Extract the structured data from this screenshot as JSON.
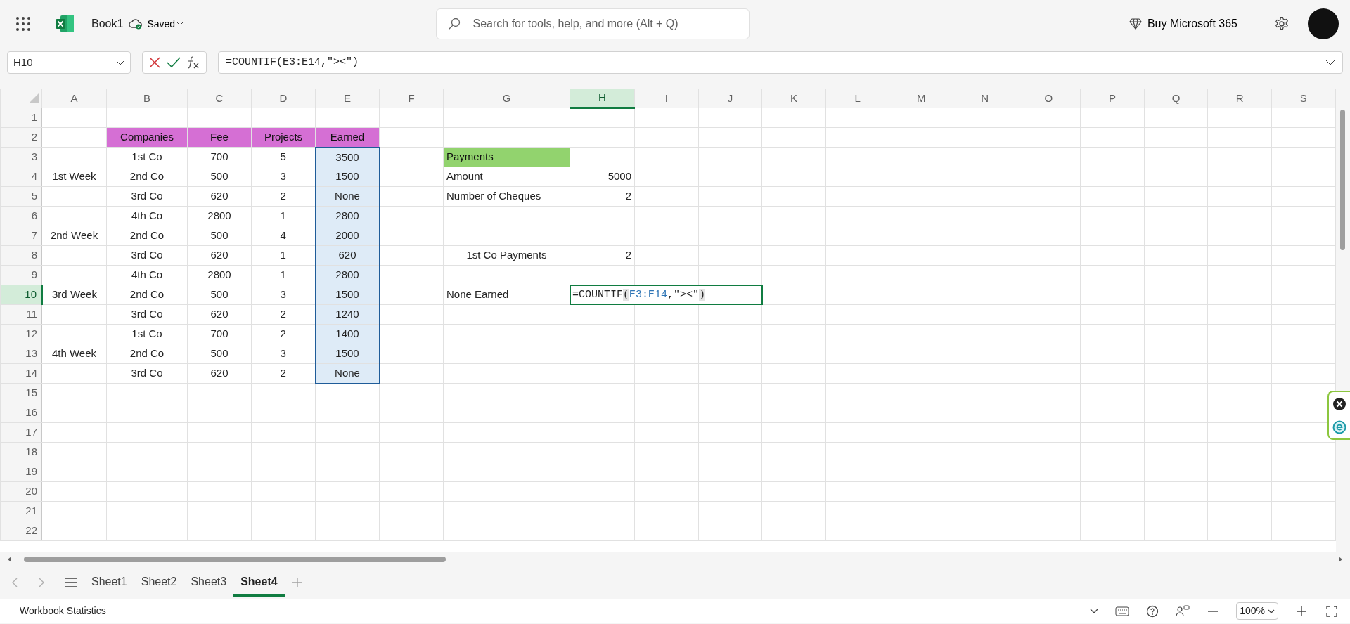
{
  "app": {
    "file_name": "Book1",
    "save_status": "Saved"
  },
  "search": {
    "placeholder": "Search for tools, help, and more (Alt + Q)"
  },
  "buy_button": "Buy Microsoft 365",
  "formula_bar": {
    "name_box": "H10",
    "formula": "=COUNTIF(E3:E14,\"><\")"
  },
  "grid": {
    "columns": [
      {
        "label": "A",
        "selected": false
      },
      {
        "label": "B",
        "selected": false
      },
      {
        "label": "C",
        "selected": false
      },
      {
        "label": "D",
        "selected": false
      },
      {
        "label": "E",
        "selected": false
      },
      {
        "label": "F",
        "selected": false
      },
      {
        "label": "G",
        "selected": false
      },
      {
        "label": "H",
        "selected": true
      },
      {
        "label": "I",
        "selected": false
      },
      {
        "label": "J",
        "selected": false
      },
      {
        "label": "K",
        "selected": false
      },
      {
        "label": "L",
        "selected": false
      },
      {
        "label": "M",
        "selected": false
      },
      {
        "label": "N",
        "selected": false
      },
      {
        "label": "O",
        "selected": false
      },
      {
        "label": "P",
        "selected": false
      },
      {
        "label": "Q",
        "selected": false
      },
      {
        "label": "R",
        "selected": false
      },
      {
        "label": "S",
        "selected": false
      }
    ],
    "rows": [
      {
        "label": "1",
        "selected": false,
        "cells": {}
      },
      {
        "label": "2",
        "selected": false,
        "cells": {
          "B": {
            "text": "Companies",
            "kind": "header",
            "selected": false
          },
          "C": {
            "text": "Fee",
            "kind": "header",
            "selected": false
          },
          "D": {
            "text": "Projects",
            "kind": "header",
            "selected": false
          },
          "E": {
            "text": "Earned",
            "kind": "header",
            "selected": false
          }
        }
      },
      {
        "label": "3",
        "selected": false,
        "cells": {
          "B": {
            "text": "1st Co",
            "kind": "center",
            "selected": false
          },
          "C": {
            "text": "700",
            "kind": "center",
            "selected": false
          },
          "D": {
            "text": "5",
            "kind": "center",
            "selected": false
          },
          "E": {
            "text": "3500",
            "kind": "center",
            "selected": true
          },
          "G": {
            "text": "Payments",
            "kind": "title",
            "selected": false
          }
        }
      },
      {
        "label": "4",
        "selected": false,
        "cells": {
          "A": {
            "text": "1st Week",
            "kind": "center",
            "selected": false
          },
          "B": {
            "text": "2nd Co",
            "kind": "center",
            "selected": false
          },
          "C": {
            "text": "500",
            "kind": "center",
            "selected": false
          },
          "D": {
            "text": "3",
            "kind": "center",
            "selected": false
          },
          "E": {
            "text": "1500",
            "kind": "center",
            "selected": true
          },
          "G": {
            "text": "Amount",
            "kind": "left",
            "selected": false
          },
          "H": {
            "text": "5000",
            "kind": "right",
            "selected": false
          }
        }
      },
      {
        "label": "5",
        "selected": false,
        "cells": {
          "B": {
            "text": "3rd Co",
            "kind": "center",
            "selected": false
          },
          "C": {
            "text": "620",
            "kind": "center",
            "selected": false
          },
          "D": {
            "text": "2",
            "kind": "center",
            "selected": false
          },
          "E": {
            "text": "None",
            "kind": "center",
            "selected": true
          },
          "G": {
            "text": "Number of Cheques",
            "kind": "left",
            "selected": false
          },
          "H": {
            "text": "2",
            "kind": "right",
            "selected": false
          }
        }
      },
      {
        "label": "6",
        "selected": false,
        "cells": {
          "B": {
            "text": "4th Co",
            "kind": "center",
            "selected": false
          },
          "C": {
            "text": "2800",
            "kind": "center",
            "selected": false
          },
          "D": {
            "text": "1",
            "kind": "center",
            "selected": false
          },
          "E": {
            "text": "2800",
            "kind": "center",
            "selected": true
          }
        }
      },
      {
        "label": "7",
        "selected": false,
        "cells": {
          "A": {
            "text": "2nd Week",
            "kind": "center",
            "selected": false
          },
          "B": {
            "text": "2nd Co",
            "kind": "center",
            "selected": false
          },
          "C": {
            "text": "500",
            "kind": "center",
            "selected": false
          },
          "D": {
            "text": "4",
            "kind": "center",
            "selected": false
          },
          "E": {
            "text": "2000",
            "kind": "center",
            "selected": true
          }
        }
      },
      {
        "label": "8",
        "selected": false,
        "cells": {
          "B": {
            "text": "3rd Co",
            "kind": "center",
            "selected": false
          },
          "C": {
            "text": "620",
            "kind": "center",
            "selected": false
          },
          "D": {
            "text": "1",
            "kind": "center",
            "selected": false
          },
          "E": {
            "text": "620",
            "kind": "center",
            "selected": true
          },
          "G": {
            "text": "1st Co Payments",
            "kind": "center",
            "selected": false
          },
          "H": {
            "text": "2",
            "kind": "right",
            "selected": false
          }
        }
      },
      {
        "label": "9",
        "selected": false,
        "cells": {
          "B": {
            "text": "4th Co",
            "kind": "center",
            "selected": false
          },
          "C": {
            "text": "2800",
            "kind": "center",
            "selected": false
          },
          "D": {
            "text": "1",
            "kind": "center",
            "selected": false
          },
          "E": {
            "text": "2800",
            "kind": "center",
            "selected": true
          }
        }
      },
      {
        "label": "10",
        "selected": true,
        "cells": {
          "A": {
            "text": "3rd Week",
            "kind": "center",
            "selected": false
          },
          "B": {
            "text": "2nd Co",
            "kind": "center",
            "selected": false
          },
          "C": {
            "text": "500",
            "kind": "center",
            "selected": false
          },
          "D": {
            "text": "3",
            "kind": "center",
            "selected": false
          },
          "E": {
            "text": "1500",
            "kind": "center",
            "selected": true
          },
          "G": {
            "text": "None Earned",
            "kind": "left",
            "selected": false
          },
          "H": {
            "kind": "editor",
            "selected": false,
            "parts": [
              {
                "text": "=COUNTIF",
                "kind": "plain"
              },
              {
                "text": "(",
                "kind": "bracket"
              },
              {
                "text": "E3:E14",
                "kind": "reference"
              },
              {
                "text": ",\"><\"",
                "kind": "plain"
              },
              {
                "text": ")",
                "kind": "bracket"
              }
            ]
          }
        }
      },
      {
        "label": "11",
        "selected": false,
        "cells": {
          "B": {
            "text": "3rd Co",
            "kind": "center",
            "selected": false
          },
          "C": {
            "text": "620",
            "kind": "center",
            "selected": false
          },
          "D": {
            "text": "2",
            "kind": "center",
            "selected": false
          },
          "E": {
            "text": "1240",
            "kind": "center",
            "selected": true
          }
        }
      },
      {
        "label": "12",
        "selected": false,
        "cells": {
          "B": {
            "text": "1st Co",
            "kind": "center",
            "selected": false
          },
          "C": {
            "text": "700",
            "kind": "center",
            "selected": false
          },
          "D": {
            "text": "2",
            "kind": "center",
            "selected": false
          },
          "E": {
            "text": "1400",
            "kind": "center",
            "selected": true
          }
        }
      },
      {
        "label": "13",
        "selected": false,
        "cells": {
          "A": {
            "text": "4th Week",
            "kind": "center",
            "selected": false
          },
          "B": {
            "text": "2nd Co",
            "kind": "center",
            "selected": false
          },
          "C": {
            "text": "500",
            "kind": "center",
            "selected": false
          },
          "D": {
            "text": "3",
            "kind": "center",
            "selected": false
          },
          "E": {
            "text": "1500",
            "kind": "center",
            "selected": true
          }
        }
      },
      {
        "label": "14",
        "selected": false,
        "cells": {
          "B": {
            "text": "3rd Co",
            "kind": "center",
            "selected": false
          },
          "C": {
            "text": "620",
            "kind": "center",
            "selected": false
          },
          "D": {
            "text": "2",
            "kind": "center",
            "selected": false
          },
          "E": {
            "text": "None",
            "kind": "center",
            "selected": true
          }
        }
      },
      {
        "label": "15",
        "selected": false,
        "cells": {}
      },
      {
        "label": "16",
        "selected": false,
        "cells": {}
      },
      {
        "label": "17",
        "selected": false,
        "cells": {}
      },
      {
        "label": "18",
        "selected": false,
        "cells": {}
      },
      {
        "label": "19",
        "selected": false,
        "cells": {}
      },
      {
        "label": "20",
        "selected": false,
        "cells": {}
      },
      {
        "label": "21",
        "selected": false,
        "cells": {}
      },
      {
        "label": "22",
        "selected": false,
        "cells": {}
      }
    ]
  },
  "sheet_tabs": [
    {
      "label": "Sheet1",
      "selected": false
    },
    {
      "label": "Sheet2",
      "selected": false
    },
    {
      "label": "Sheet3",
      "selected": false
    },
    {
      "label": "Sheet4",
      "selected": true
    }
  ],
  "status_bar": {
    "label": "Workbook Statistics",
    "zoom": "100%"
  }
}
